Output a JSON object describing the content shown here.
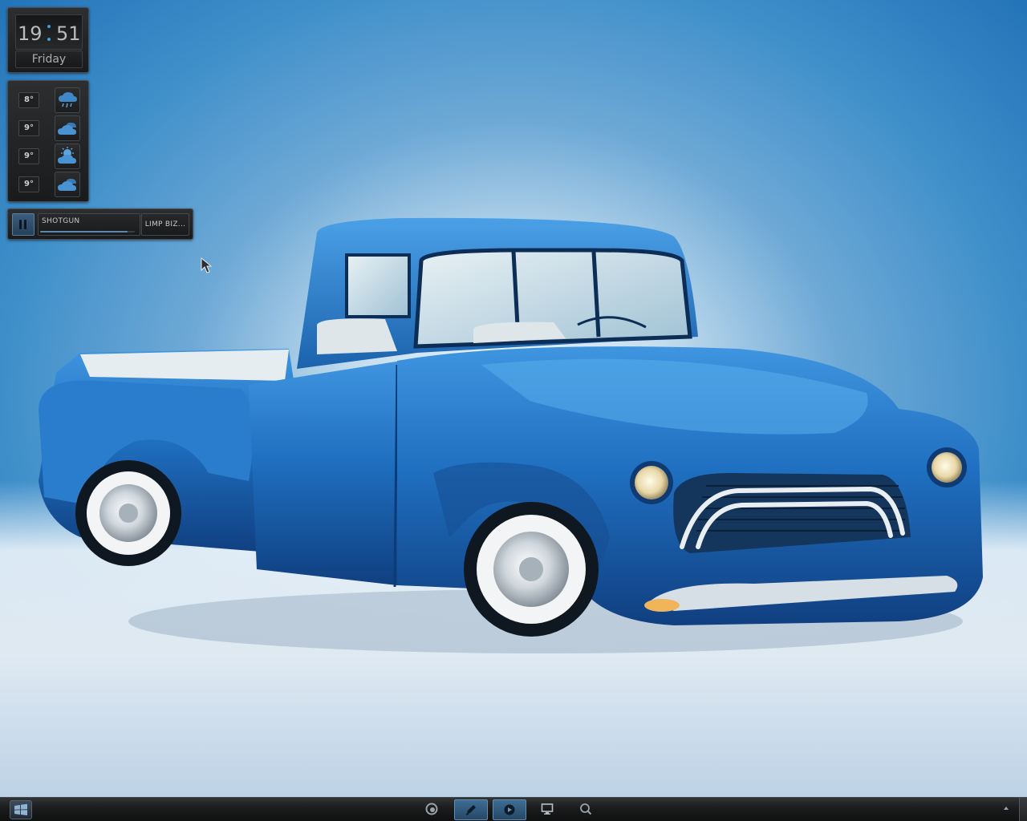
{
  "clock": {
    "hour": "19",
    "minute": "51",
    "day": "Friday"
  },
  "weather": {
    "rows": [
      {
        "temp": "8°",
        "icon": "rain-cloud-icon"
      },
      {
        "temp": "9°",
        "icon": "cloudy-icon"
      },
      {
        "temp": "9°",
        "icon": "partly-sunny-icon"
      },
      {
        "temp": "9°",
        "icon": "cloudy-icon"
      }
    ]
  },
  "player": {
    "track": "SHOTGUN",
    "artist": "LIMP BIZ...",
    "progress": 0.92
  },
  "taskbar": {
    "start_icon": "windows-logo-icon",
    "apps": [
      {
        "icon": "browser-icon",
        "active": false
      },
      {
        "icon": "pen-icon",
        "active": true
      },
      {
        "icon": "media-player-icon",
        "active": true
      },
      {
        "icon": "monitor-icon",
        "active": false
      },
      {
        "icon": "search-icon",
        "active": false
      }
    ],
    "tray_icon": "tray-arrow-icon"
  },
  "colors": {
    "accent": "#3d9ce0",
    "truck_body": "#1f6fc0",
    "wallpaper": "#3f8fca"
  }
}
